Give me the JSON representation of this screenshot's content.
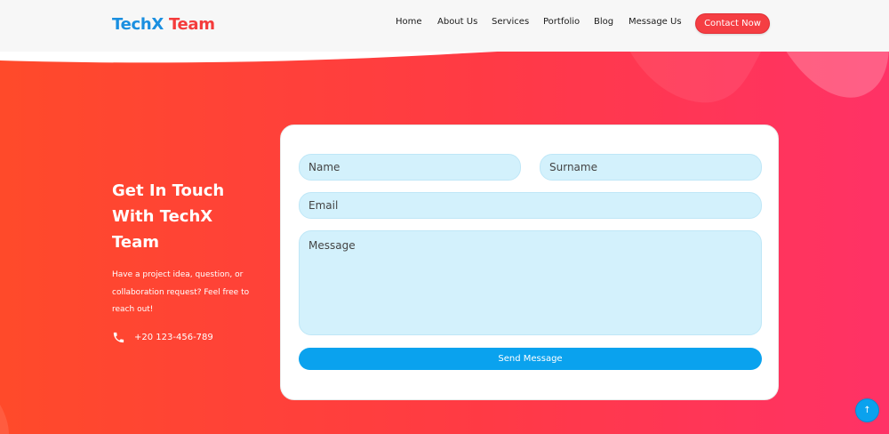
{
  "brand": {
    "part1": "TechX",
    "part2": "Team"
  },
  "nav": {
    "links": [
      "Home",
      "About Us",
      "Services",
      "Portfolio",
      "Blog",
      "Message Us"
    ],
    "cta": "Contact Now"
  },
  "intro": {
    "title": "Get In Touch With TechX Team",
    "text": "Have a project idea, question, or collaboration request? Feel free to reach out!",
    "phone": "+20 123-456-789"
  },
  "form": {
    "name_placeholder": "Name",
    "surname_placeholder": "Surname",
    "email_placeholder": "Email",
    "message_placeholder": "Message",
    "submit": "Send Message"
  },
  "scroll_top_icon": "↑",
  "colors": {
    "brand_blue": "#1a8fe0",
    "brand_red": "#f43b3b",
    "gradient_start": "#ff4a2a",
    "gradient_end": "#ff3266",
    "field_bg": "#d3f1fc",
    "button_blue": "#0aa2ee"
  }
}
